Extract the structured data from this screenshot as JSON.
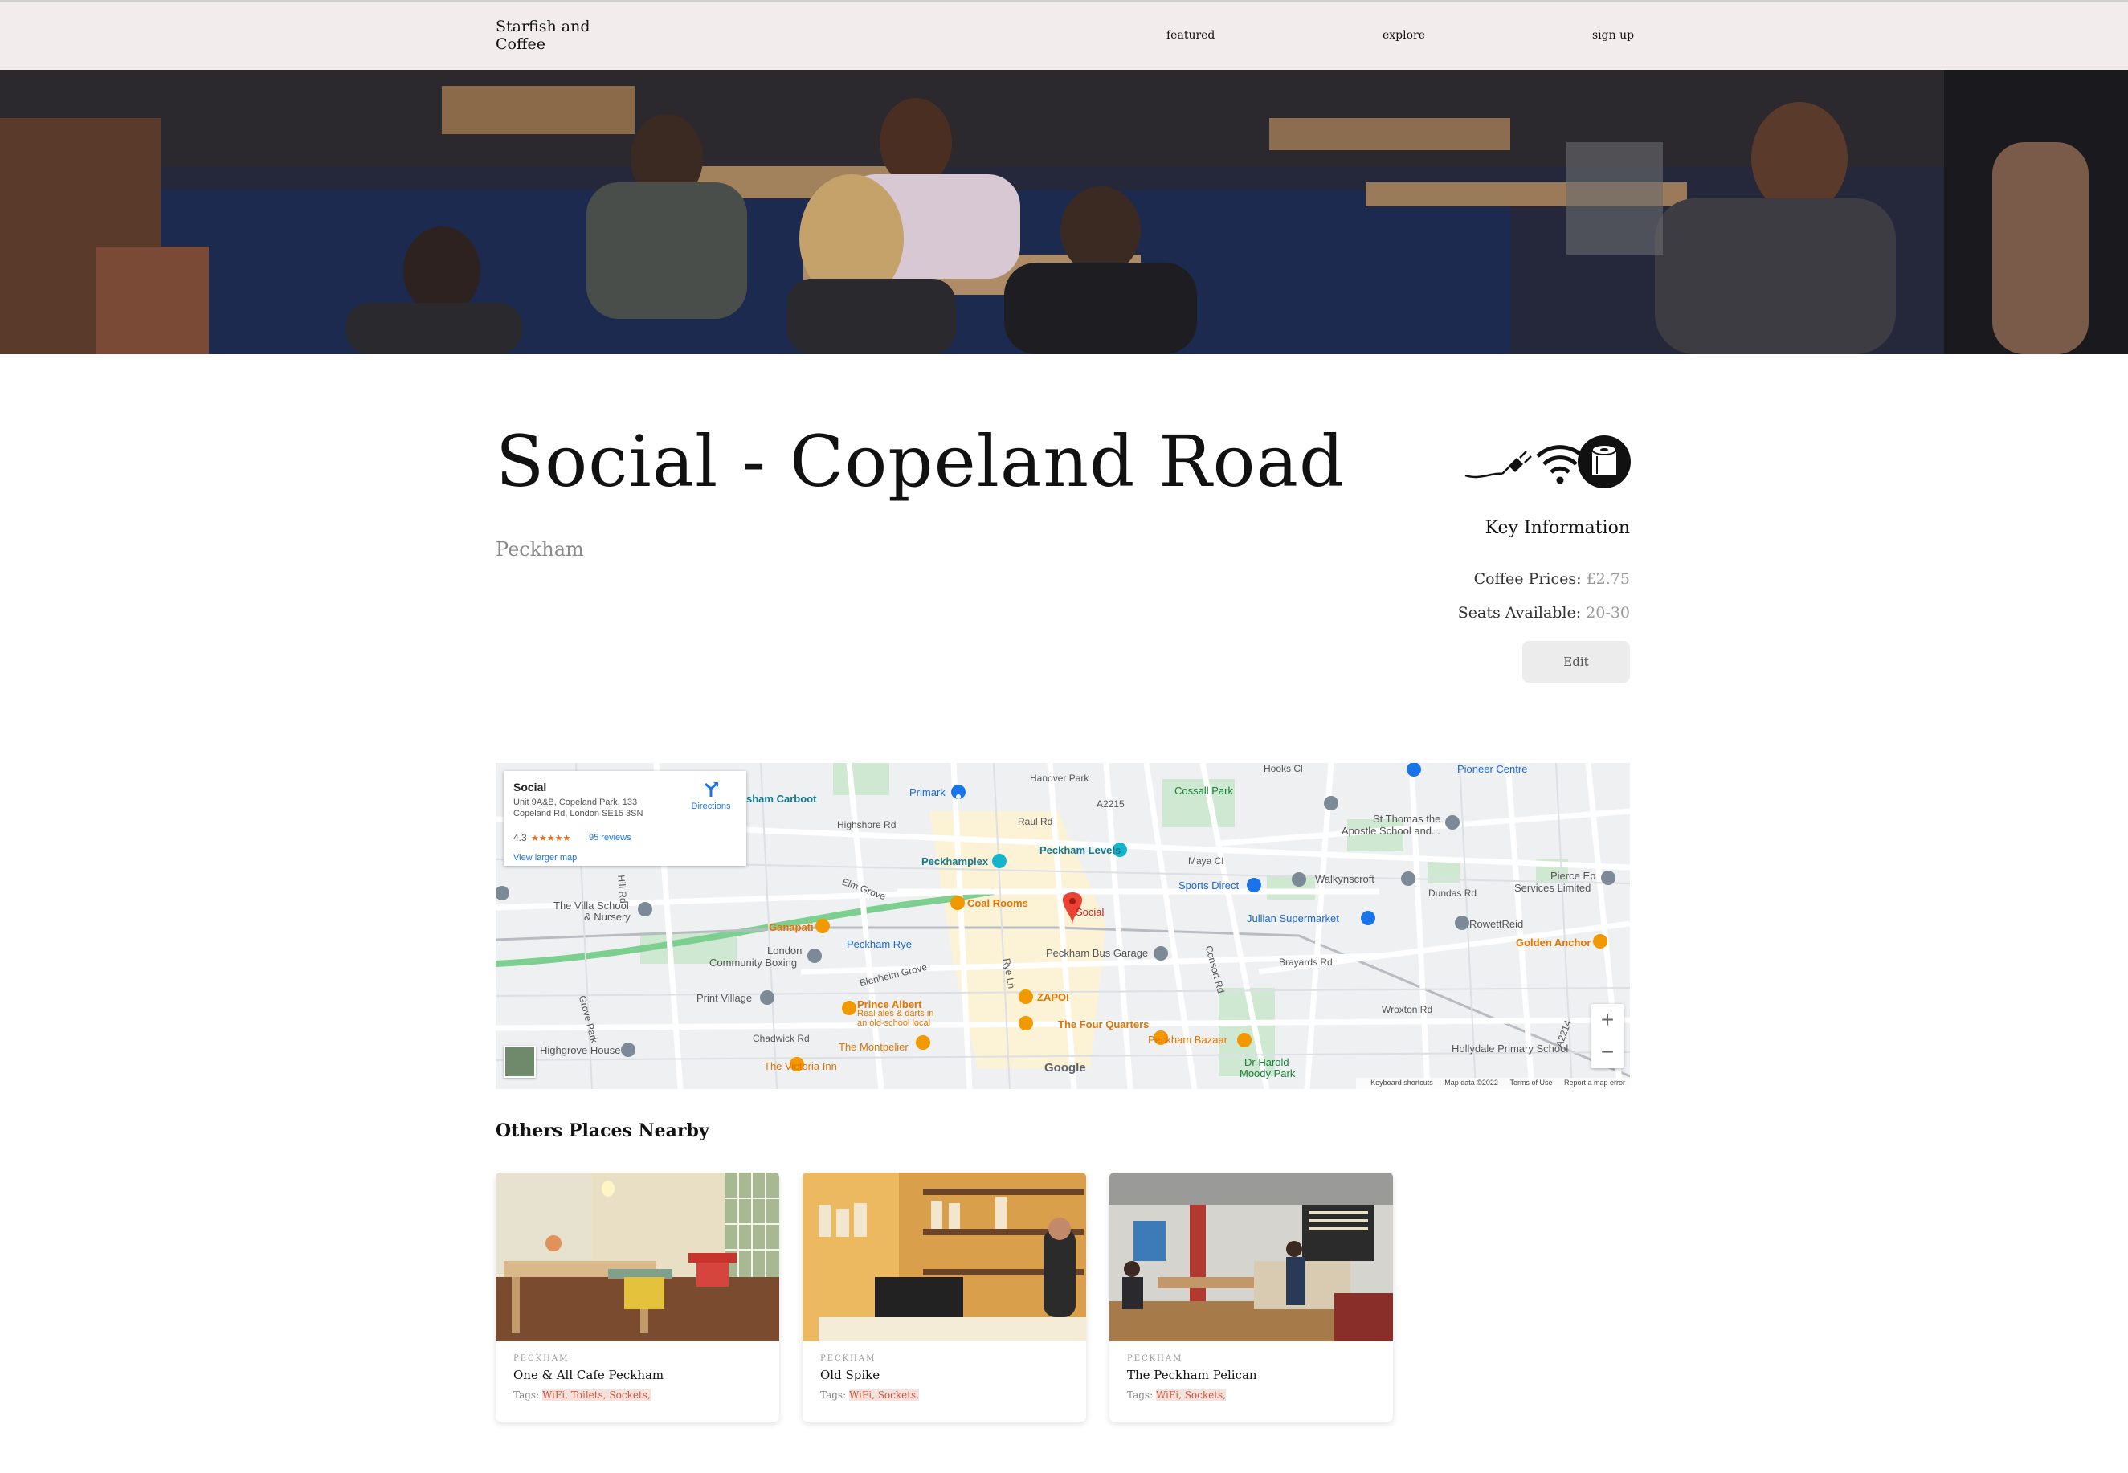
{
  "nav": {
    "brand": "Starfish and Coffee",
    "links": [
      "featured",
      "explore",
      "sign up"
    ]
  },
  "place": {
    "title": "Social - Copeland Road",
    "area": "Peckham",
    "amenity_icons": [
      "power-socket-icon",
      "wifi-icon",
      "toilet-roll-icon"
    ]
  },
  "key_info": {
    "title": "Key Information",
    "coffee_label": "Coffee Prices:",
    "coffee_value": "£2.75",
    "seats_label": "Seats Available:",
    "seats_value": "20-30",
    "edit_label": "Edit"
  },
  "map": {
    "card_name": "Social",
    "card_address": "Unit 9A&B, Copeland Park, 133 Copeland Rd, London SE15 3SN",
    "card_rating": "4.3",
    "card_stars": "★★★★★",
    "card_reviews": "95 reviews",
    "card_directions": "Directions",
    "card_larger": "View larger map",
    "marker_label": "Social",
    "zoom_in": "+",
    "zoom_out": "−",
    "google": "Google",
    "footer": [
      "Keyboard shortcuts",
      "Map data ©2022",
      "Terms of Use",
      "Report a map error"
    ],
    "labels": {
      "carboot": "sham Carboot",
      "primark": "Primark",
      "hanover": "Hanover Park",
      "cossall": "Cossall Park",
      "hooks": "Hooks Cl",
      "pioneer": "Pioneer Centre",
      "highshore": "Highshore Rd",
      "raul": "Raul Rd",
      "a2215": "A2215",
      "st_thomas": "St Thomas the",
      "st_thomas2": "Apostle School and...",
      "peckhamplex": "Peckhamplex",
      "levels": "Peckham Levels",
      "maya": "Maya Cl",
      "walkynscroft": "Walkynscroft",
      "pierce": "Pierce Ep",
      "pierce2": "Services Limited",
      "villa": "The Villa School",
      "villa2": "& Nursery",
      "coal": "Coal Rooms",
      "sports": "Sports Direct",
      "dundas": "Dundas Rd",
      "jullian": "Jullian Supermarket",
      "rowett": "RowettReid",
      "ganapati": "Ganapati",
      "peckham_rye": "Peckham Rye",
      "golden": "Golden Anchor",
      "london_boxing": "London",
      "london_boxing2": "Community Boxing",
      "bus_garage": "Peckham Bus Garage",
      "brayards": "Brayards Rd",
      "print": "Print Village",
      "zapoi": "ZAPOI",
      "prince": "Prince Albert",
      "prince2": "Real ales & darts in",
      "prince3": "an old-school local",
      "chadwick": "Chadwick Rd",
      "four_quarters": "The Four Quarters",
      "wroxton": "Wroxton Rd",
      "hollydale": "Hollydale Primary School",
      "highgrove": "Highgrove House",
      "montpelier": "The Montpelier",
      "bazaar": "Peckham Bazaar",
      "victoria": "The Victoria Inn",
      "moody": "Dr Harold",
      "moody2": "Moody Park",
      "blenheim": "Blenheim Grove",
      "elm": "Elm Grove",
      "rye_ln": "Rye Ln",
      "consort": "Consort Rd",
      "grove_park": "Grove Park",
      "hill_rd": "Hill Rd",
      "a2214": "A2214"
    }
  },
  "nearby": {
    "title": "Others Places Nearby",
    "tags_label": "Tags:",
    "cards": [
      {
        "area": "PECKHAM",
        "name": "One & All Cafe Peckham",
        "tags": "WiFi, Toilets, Sockets,"
      },
      {
        "area": "PECKHAM",
        "name": "Old Spike",
        "tags": "WiFi, Sockets,"
      },
      {
        "area": "PECKHAM",
        "name": "The Peckham Pelican",
        "tags": "WiFi, Sockets,"
      }
    ]
  },
  "colors": {
    "nav_bg": "#f3eced",
    "tag_text": "#c9573f",
    "tag_bg": "#f6e2dd",
    "map_marker": "#ea4335"
  }
}
